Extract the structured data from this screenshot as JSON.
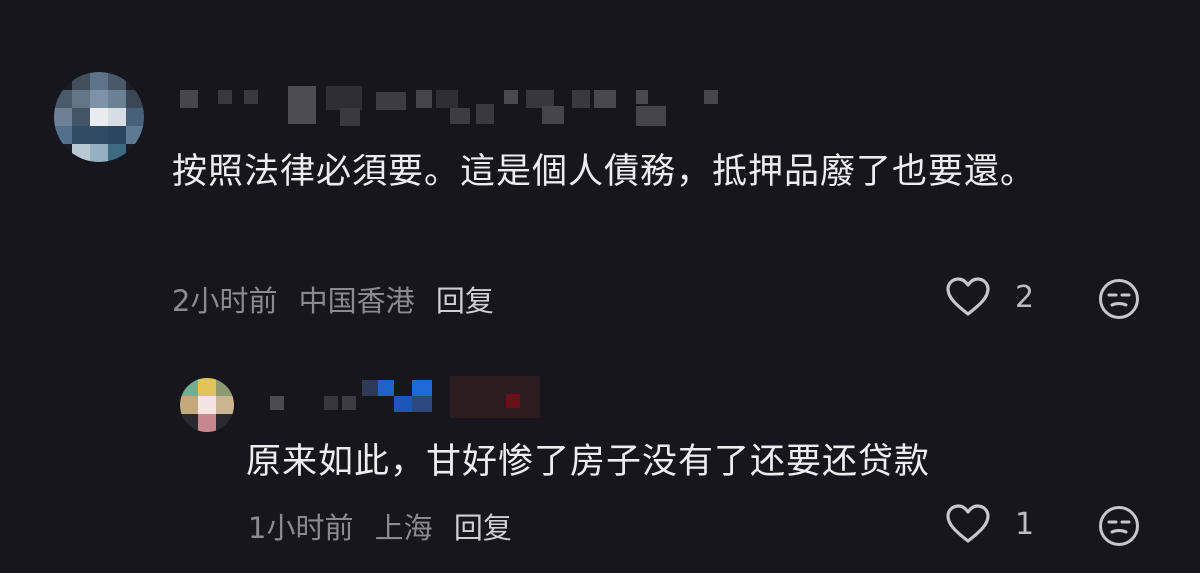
{
  "comments": [
    {
      "text": "按照法律必須要。這是個人債務，抵押品廢了也要還。",
      "time": "2小时前",
      "location": "中国香港",
      "reply_label": "回复",
      "likes": "2",
      "like_icon": "heart-outline-icon",
      "emoji_icon": "sleepy-face-icon"
    }
  ],
  "replies": [
    {
      "text": "原来如此，甘好惨了房子没有了还要还贷款",
      "time": "1小时前",
      "location": "上海",
      "reply_label": "回复",
      "likes": "1",
      "like_icon": "heart-outline-icon",
      "emoji_icon": "sleepy-face-icon"
    }
  ],
  "colors": {
    "background": "#17161c",
    "text": "#ededf0",
    "meta": "#8b8a91",
    "icon": "#c7c6cc"
  }
}
